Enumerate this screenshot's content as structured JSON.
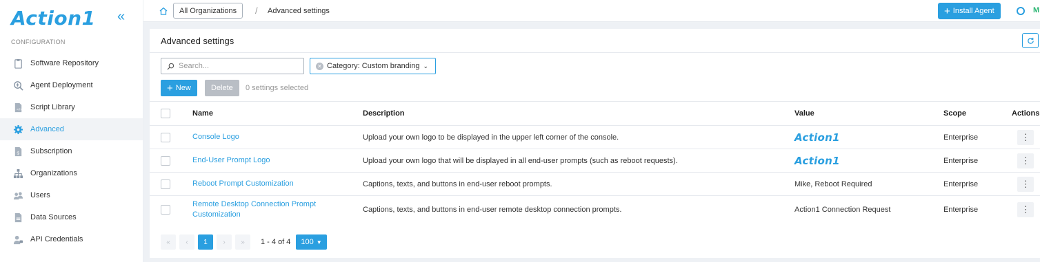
{
  "app": {
    "logo_text": "Action1",
    "brand_color": "#2a9fe0"
  },
  "sidebar": {
    "section_label": "CONFIGURATION",
    "items": [
      {
        "label": "Software Repository",
        "icon": "clipboard-icon"
      },
      {
        "label": "Agent Deployment",
        "icon": "magnifier-plus-icon"
      },
      {
        "label": "Script Library",
        "icon": "script-file-icon"
      },
      {
        "label": "Advanced",
        "icon": "gear-icon",
        "active": true
      },
      {
        "label": "Subscription",
        "icon": "dollar-file-icon"
      },
      {
        "label": "Organizations",
        "icon": "org-chart-icon"
      },
      {
        "label": "Users",
        "icon": "users-icon"
      },
      {
        "label": "Data Sources",
        "icon": "data-file-icon"
      },
      {
        "label": "API Credentials",
        "icon": "user-key-icon"
      }
    ]
  },
  "topbar": {
    "org_button": "All Organizations",
    "separator": "/",
    "breadcrumb": "Advanced settings",
    "install_button": "Install Agent",
    "user_initial": "M"
  },
  "page": {
    "title": "Advanced settings",
    "search_placeholder": "Search...",
    "filter_label": "Category: Custom branding",
    "new_button": "New",
    "delete_button": "Delete",
    "selected_count": "0 settings selected"
  },
  "table": {
    "columns": {
      "name": "Name",
      "description": "Description",
      "value": "Value",
      "scope": "Scope",
      "actions": "Actions"
    },
    "rows": [
      {
        "name": "Console Logo",
        "description": "Upload your own logo to be displayed in the upper left corner of the console.",
        "value": "Action1",
        "value_is_logo": true,
        "scope": "Enterprise"
      },
      {
        "name": "End-User Prompt Logo",
        "description": "Upload your own logo that will be displayed in all end-user prompts (such as reboot requests).",
        "value": "Action1",
        "value_is_logo": true,
        "scope": "Enterprise"
      },
      {
        "name": "Reboot Prompt Customization",
        "description": "Captions, texts, and buttons in end-user reboot prompts.",
        "value": "Mike, Reboot Required",
        "value_is_logo": false,
        "scope": "Enterprise"
      },
      {
        "name": "Remote Desktop Connection Prompt Customization",
        "description": "Captions, texts, and buttons in end-user remote desktop connection prompts.",
        "value": "Action1 Connection Request",
        "value_is_logo": false,
        "scope": "Enterprise"
      }
    ]
  },
  "pagination": {
    "first": "«",
    "prev": "‹",
    "current_page": "1",
    "next": "›",
    "last": "»",
    "range": "1 - 4 of 4",
    "page_size": "100"
  }
}
